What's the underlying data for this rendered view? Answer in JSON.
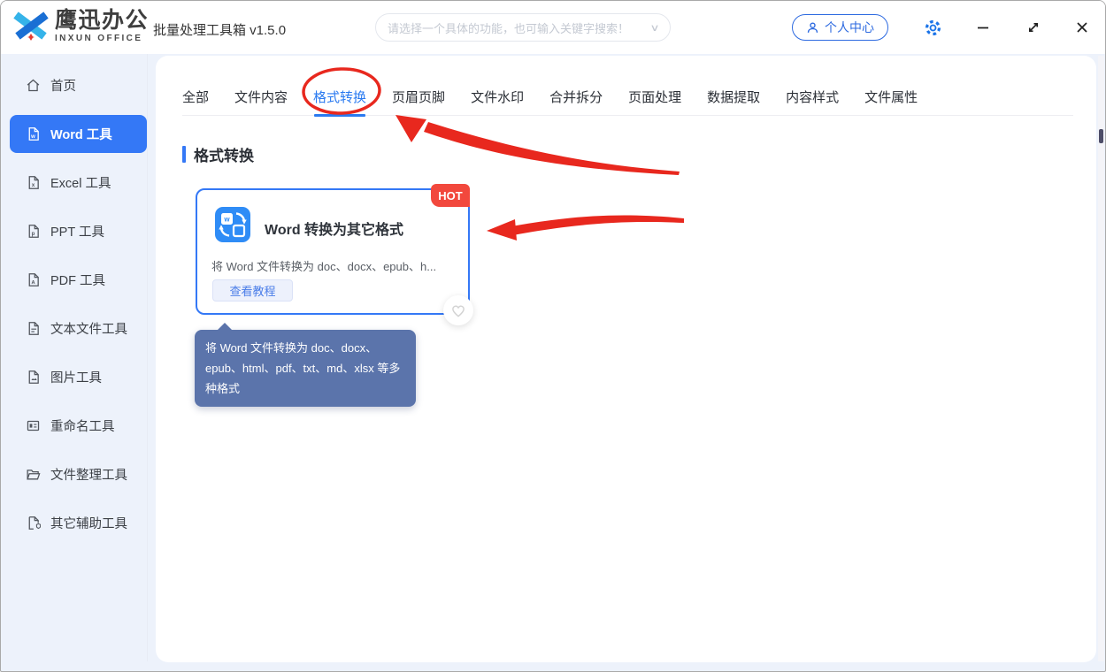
{
  "header": {
    "logo_cn": "鹰迅办公",
    "logo_en": "INXUN OFFICE",
    "app_title": "批量处理工具箱 v1.5.0",
    "search": {
      "placeholder": "请选择一个具体的功能，也可输入关键字搜索！"
    },
    "user_center_label": "个人中心"
  },
  "sidebar": {
    "items": [
      {
        "label": "首页",
        "icon": "home-icon",
        "active": false
      },
      {
        "label": "Word 工具",
        "icon": "word-file-icon",
        "active": true
      },
      {
        "label": "Excel 工具",
        "icon": "excel-file-icon",
        "active": false
      },
      {
        "label": "PPT 工具",
        "icon": "ppt-file-icon",
        "active": false
      },
      {
        "label": "PDF 工具",
        "icon": "pdf-file-icon",
        "active": false
      },
      {
        "label": "文本文件工具",
        "icon": "text-file-icon",
        "active": false
      },
      {
        "label": "图片工具",
        "icon": "image-file-icon",
        "active": false
      },
      {
        "label": "重命名工具",
        "icon": "rename-icon",
        "active": false
      },
      {
        "label": "文件整理工具",
        "icon": "folder-icon",
        "active": false
      },
      {
        "label": "其它辅助工具",
        "icon": "assist-tools-icon",
        "active": false
      }
    ]
  },
  "tabs": {
    "items": [
      "全部",
      "文件内容",
      "格式转换",
      "页眉页脚",
      "文件水印",
      "合并拆分",
      "页面处理",
      "数据提取",
      "内容样式",
      "文件属性"
    ],
    "active": "格式转换"
  },
  "section": {
    "title": "格式转换"
  },
  "card": {
    "badge": "HOT",
    "title": "Word 转换为其它格式",
    "description_truncated": "将 Word 文件转换为 doc、docx、epub、h...",
    "tutorial_button": "查看教程"
  },
  "tooltip": {
    "text": "将 Word 文件转换为 doc、docx、epub、html、pdf、txt、md、xlsx 等多种格式"
  },
  "colors": {
    "primary_blue": "#3478f6",
    "active_tab_blue": "#2a7af0",
    "hot_badge_red": "#f2483d",
    "annotation_red": "#e8281e",
    "tooltip_bg": "#5b74ab",
    "card_icon_blue": "#2f8cf6"
  }
}
